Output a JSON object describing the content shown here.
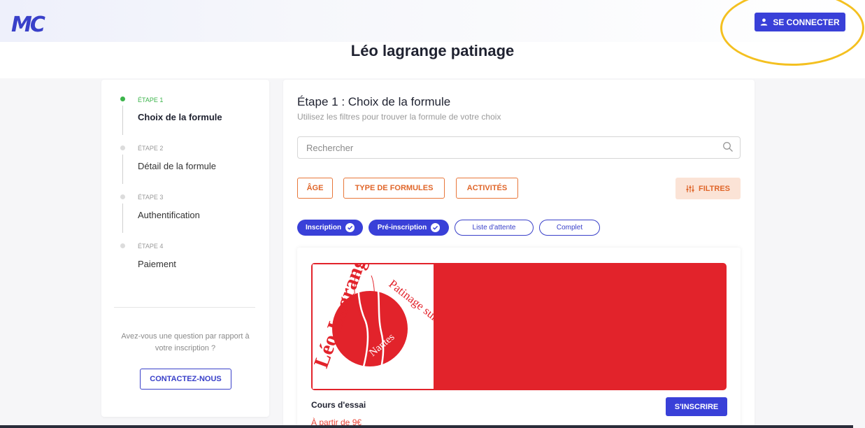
{
  "header": {
    "logo": "MC",
    "login_label": "SE CONNECTER",
    "page_title": "Léo lagrange patinage"
  },
  "stepper": {
    "steps": [
      {
        "tag": "ÉTAPE 1",
        "label": "Choix de la formule",
        "active": true
      },
      {
        "tag": "ÉTAPE 2",
        "label": "Détail de la formule",
        "active": false
      },
      {
        "tag": "ÉTAPE 3",
        "label": "Authentification",
        "active": false
      },
      {
        "tag": "ÉTAPE 4",
        "label": "Paiement",
        "active": false
      }
    ],
    "help_text": "Avez-vous une question par rapport à votre inscription ?",
    "contact_label": "CONTACTEZ-NOUS"
  },
  "main": {
    "title": "Étape 1 : Choix de la formule",
    "subtitle": "Utilisez les filtres pour trouver la formule de votre choix",
    "search_placeholder": "Rechercher",
    "filters": [
      "ÂGE",
      "TYPE DE FORMULES",
      "ACTIVITÉS"
    ],
    "filters_button": "FILTRES",
    "status_chips": [
      {
        "label": "Inscription",
        "selected": true
      },
      {
        "label": "Pré-inscription",
        "selected": true
      },
      {
        "label": "Liste d'attente",
        "selected": false
      },
      {
        "label": "Complet",
        "selected": false
      }
    ],
    "offer": {
      "name": "Cours d'essai",
      "price": "À partir de 9€",
      "button": "S'INSCRIRE",
      "logo_texts": [
        "Léo Lagrange",
        "Patinage sur glace",
        "Nantes"
      ]
    }
  },
  "colors": {
    "primary": "#3940d8",
    "accent_orange": "#e0662a",
    "success": "#3cb44b",
    "brand_red": "#e2232b",
    "highlight": "#f4c020"
  }
}
